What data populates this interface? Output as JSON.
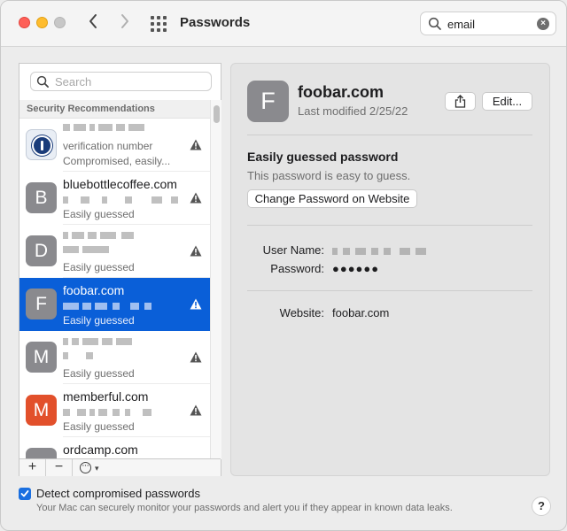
{
  "window": {
    "title": "Passwords",
    "search_value": "email",
    "nav_back_icon": "‹",
    "nav_forward_icon": "›"
  },
  "sidebar": {
    "search_placeholder": "Search",
    "section_header": "Security Recommendations",
    "items": [
      {
        "avatar": "",
        "icon": "1password-icon",
        "title": "",
        "subtitle": "verification number",
        "status": "Compromised, easily...",
        "warning": true
      },
      {
        "avatar": "B",
        "title": "bluebottlecoffee.com",
        "subtitle": "",
        "status": "Easily guessed",
        "warning": true
      },
      {
        "avatar": "D",
        "title": "",
        "subtitle": "",
        "status": "Easily guessed",
        "warning": true
      },
      {
        "avatar": "F",
        "title": "foobar.com",
        "subtitle": "",
        "status": "Easily guessed",
        "warning": true,
        "selected": true
      },
      {
        "avatar": "M",
        "title": "",
        "subtitle": "",
        "status": "Easily guessed",
        "warning": true
      },
      {
        "avatar": "M",
        "title": "memberful.com",
        "subtitle": "",
        "status": "Easily guessed",
        "warning": true,
        "color": "#e2502b"
      },
      {
        "avatar": "",
        "title": "ordcamp.com",
        "subtitle": "",
        "status": "",
        "warning": false
      }
    ],
    "footer": {
      "add_label": "+",
      "remove_label": "−"
    }
  },
  "detail": {
    "avatar": "F",
    "title": "foobar.com",
    "modified": "Last modified 2/25/22",
    "edit_label": "Edit...",
    "warning_title": "Easily guessed password",
    "warning_desc": "This password is easy to guess.",
    "change_label": "Change Password on Website",
    "username_label": "User Name:",
    "password_label": "Password:",
    "password_value": "●●●●●●",
    "website_label": "Website:",
    "website_value": "foobar.com"
  },
  "footer": {
    "detect_label": "Detect compromised passwords",
    "detect_checked": true,
    "detect_desc": "Your Mac can securely monitor your passwords and alert you if they appear in known data leaks.",
    "help_label": "?"
  },
  "colors": {
    "selection": "#0a5fd8",
    "accent": "#1a6fe0",
    "avatar_gray": "#8a8a8e",
    "avatar_orange": "#e2502b"
  }
}
